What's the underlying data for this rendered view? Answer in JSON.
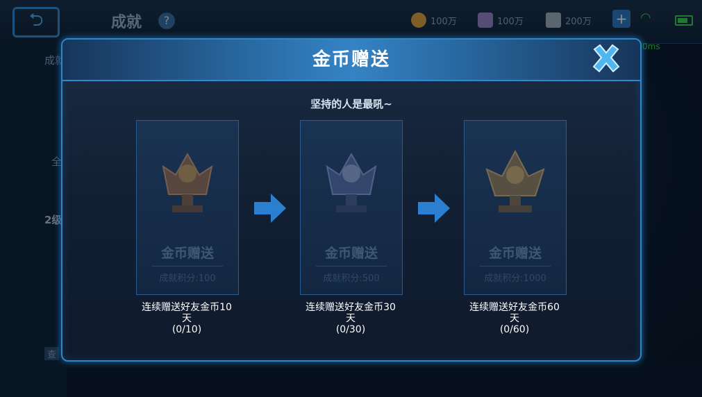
{
  "background": {
    "title": "成就",
    "help_icon": "?",
    "resources": [
      {
        "icon": "gold-coin-icon",
        "value": "100万",
        "color": "#e0a43a"
      },
      {
        "icon": "diamond-icon",
        "value": "100万",
        "color": "#9a86c9"
      },
      {
        "icon": "ticket-icon",
        "value": "200万",
        "color": "#a3b1c0"
      }
    ],
    "ping": "0ms",
    "side_texts": [
      "成就",
      "全",
      "2级",
      "查"
    ]
  },
  "modal": {
    "title": "金币赠送",
    "subtitle": "坚持的人是最吼~",
    "cards": [
      {
        "name": "金币赠送",
        "score": "成就积分:100",
        "condition_line1": "连续赠送好友金币10",
        "condition_line2": "天",
        "progress": "(0/10)",
        "tier": "bronze"
      },
      {
        "name": "金币赠送",
        "score": "成就积分:500",
        "condition_line1": "连续赠送好友金币30",
        "condition_line2": "天",
        "progress": "(0/30)",
        "tier": "silver"
      },
      {
        "name": "金币赠送",
        "score": "成就积分:1000",
        "condition_line1": "连续赠送好友金币60",
        "condition_line2": "天",
        "progress": "(0/60)",
        "tier": "gold"
      }
    ]
  },
  "colors": {
    "accent": "#2f86c7",
    "header": "#3583c4",
    "online": "#3fcf57"
  }
}
